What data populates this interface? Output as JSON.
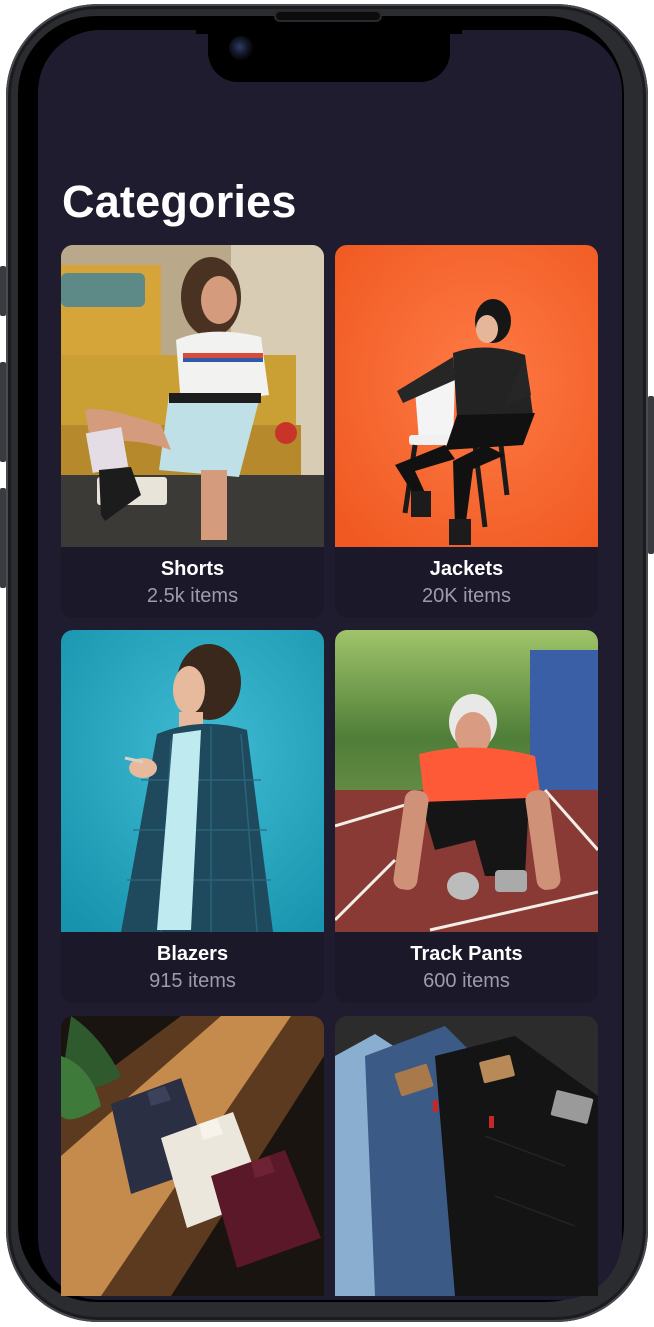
{
  "page": {
    "title": "Categories"
  },
  "categories": [
    {
      "label": "Shorts",
      "count": "2.5k items",
      "image": "woman-in-shorts-photo"
    },
    {
      "label": "Jackets",
      "count": "20K items",
      "image": "woman-in-leather-jacket-photo"
    },
    {
      "label": "Blazers",
      "count": "915 items",
      "image": "person-in-blazer-photo"
    },
    {
      "label": "Track Pants",
      "count": "600 items",
      "image": "runner-on-track-photo"
    },
    {
      "label": "",
      "count": "",
      "image": "folded-shirts-photo"
    },
    {
      "label": "",
      "count": "",
      "image": "stacked-jeans-photo"
    }
  ],
  "colors": {
    "screen_background": "#1e1c2e",
    "card_background": "#1a1829",
    "title_text": "#ffffff",
    "count_text": "#9e9cab"
  }
}
